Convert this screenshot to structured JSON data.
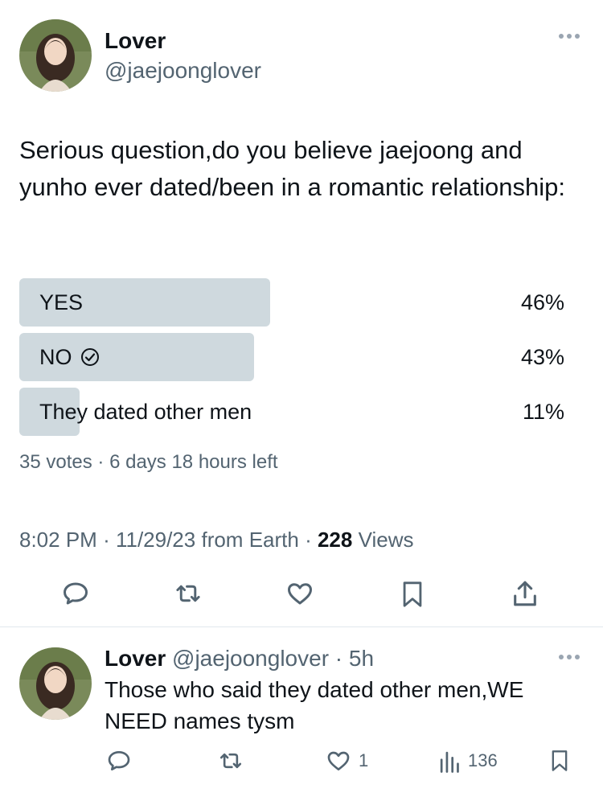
{
  "tweet": {
    "author_name": "Lover",
    "author_handle": "@jaejoonglover",
    "more_icon": "more-dots-icon",
    "text": "Serious question,do you believe jaejoong and yunho ever dated/been in a romantic relationship:",
    "poll": {
      "options": [
        {
          "label": "YES",
          "percent_text": "46%",
          "fraction": 0.46,
          "selected": false
        },
        {
          "label": "NO",
          "percent_text": "43%",
          "fraction": 0.43,
          "selected": true
        },
        {
          "label": "They dated other men",
          "percent_text": "11%",
          "fraction": 0.11,
          "selected": false
        }
      ],
      "votes_text": "35 votes",
      "time_left_text": "6 days 18 hours left"
    },
    "time": "8:02 PM",
    "date": "11/29/23",
    "source": "from Earth",
    "views_count": "228",
    "views_label": "Views",
    "actions": [
      "reply-icon",
      "retweet-icon",
      "like-icon",
      "bookmark-icon",
      "share-icon"
    ]
  },
  "reply": {
    "author_name": "Lover",
    "author_handle": "@jaejoonglover",
    "age": "5h",
    "text": "Those who said they dated other men,WE NEED names tysm",
    "likes": "1",
    "views": "136"
  },
  "colors": {
    "poll_fill": "#cfd9de",
    "muted": "#536471",
    "text": "#0f1419"
  }
}
